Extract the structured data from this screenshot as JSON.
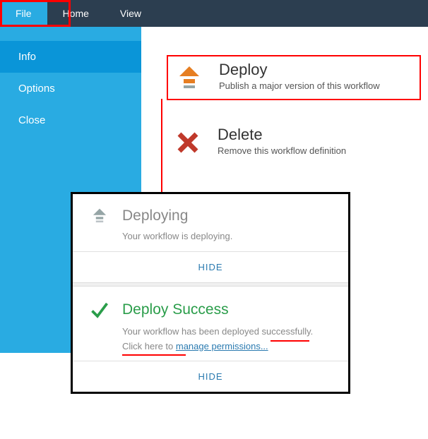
{
  "topbar": {
    "tabs": [
      {
        "label": "File",
        "active": true
      },
      {
        "label": "Home",
        "active": false
      },
      {
        "label": "View",
        "active": false
      }
    ]
  },
  "sidebar": {
    "items": [
      {
        "label": "Info",
        "active": true
      },
      {
        "label": "Options",
        "active": false
      },
      {
        "label": "Close",
        "active": false
      }
    ]
  },
  "actions": {
    "deploy": {
      "title": "Deploy",
      "sub": "Publish a major version of this workflow"
    },
    "delete": {
      "title": "Delete",
      "sub": "Remove this workflow definition"
    }
  },
  "dialog": {
    "deploying": {
      "title": "Deploying",
      "body": "Your workflow is deploying.",
      "hide": "HIDE"
    },
    "success": {
      "title": "Deploy Success",
      "body_prefix": "Your workflow has been deployed successfully. Click here to ",
      "link": "manage permissions...",
      "hide": "HIDE"
    }
  }
}
